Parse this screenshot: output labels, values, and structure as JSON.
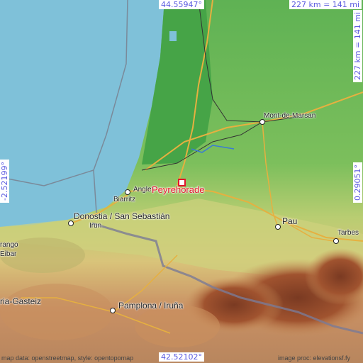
{
  "map": {
    "focus": {
      "name": "Peyrehorade"
    },
    "coordinates": {
      "top_lat": "44.55947°",
      "bottom_lat": "42.52102°",
      "left_lon": "-2.52199°",
      "right_lon": "0.29051°"
    },
    "scale": {
      "horizontal": "227 km = 141 mi",
      "vertical": "227 km = 141 mi"
    },
    "places": [
      {
        "id": "mont-de-marsan",
        "name": "Mont-de-Marsan"
      },
      {
        "id": "anglet",
        "name": "Anglet"
      },
      {
        "id": "biarritz",
        "name": "Biarritz"
      },
      {
        "id": "donostia",
        "name": "Donostia / San Sebastián"
      },
      {
        "id": "irun",
        "name": "Irun"
      },
      {
        "id": "pau",
        "name": "Pau"
      },
      {
        "id": "tarbes",
        "name": "Tarbes"
      },
      {
        "id": "arrasate",
        "name": "rango"
      },
      {
        "id": "eibar",
        "name": "Eibar"
      },
      {
        "id": "vitoria",
        "name": "ria-Gasteiz"
      },
      {
        "id": "pamplona",
        "name": "Pamplona / Iruña"
      }
    ],
    "attribution": {
      "left": "map data: openstreetmap, style: opentopomap",
      "right": "image proc: elevationsf.fy"
    },
    "colors": {
      "sea": "#7fc1d9",
      "lowland": "#3fa33f",
      "hills": "#cbd27a",
      "mountains": "#a0532f",
      "focus": "#e2142b",
      "coord_text": "#5b5be0"
    }
  }
}
